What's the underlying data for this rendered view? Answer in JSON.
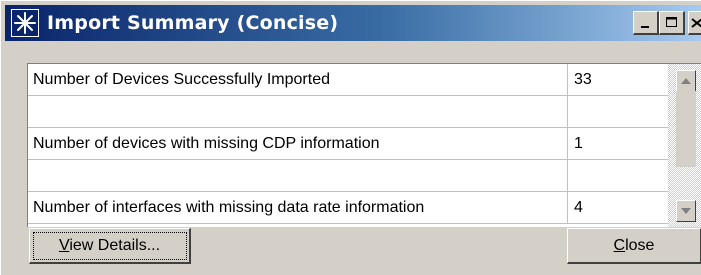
{
  "window": {
    "title": "Import Summary (Concise)",
    "title_icon": "star-burst-icon"
  },
  "rows": [
    {
      "label": "Number of Devices Successfully Imported",
      "value": "33"
    },
    {
      "label": "",
      "value": ""
    },
    {
      "label": "Number of devices with missing CDP information",
      "value": "1"
    },
    {
      "label": "",
      "value": ""
    },
    {
      "label": "Number of interfaces with missing data rate information",
      "value": "4"
    }
  ],
  "buttons": {
    "view_details": "View Details...",
    "close": "Close"
  },
  "colors": {
    "titlebar_start": "#0a246a",
    "titlebar_end": "#a6caf0",
    "face": "#d4d0c8"
  }
}
